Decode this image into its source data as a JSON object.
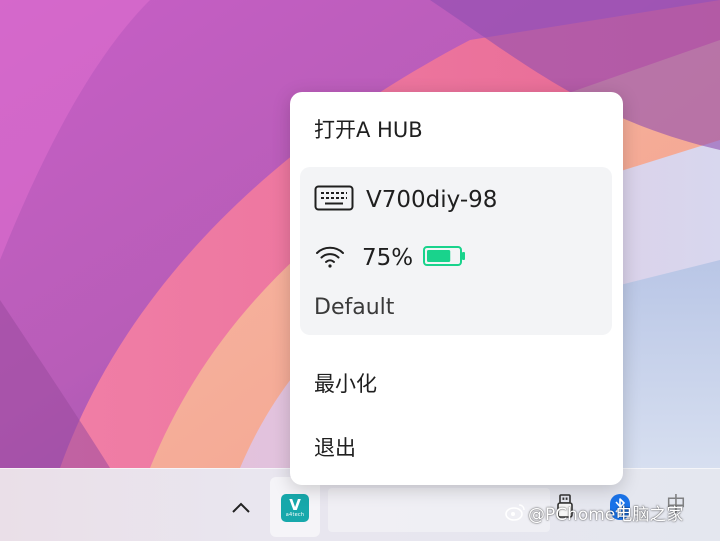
{
  "menu": {
    "open_hub": "打开A HUB",
    "device": {
      "name": "V700diy-98",
      "battery_percent_label": "75%",
      "battery_level": 0.75,
      "profile": "Default"
    },
    "minimize": "最小化",
    "exit": "退出"
  },
  "taskbar": {
    "app_icon_mark": "V",
    "app_icon_sub": "a4tech",
    "ime_label": "中"
  },
  "watermark": "@PChome电脑之家",
  "colors": {
    "battery": "#19d38c",
    "app_icon": "#17a8ab",
    "bluetooth": "#1a73e8"
  }
}
